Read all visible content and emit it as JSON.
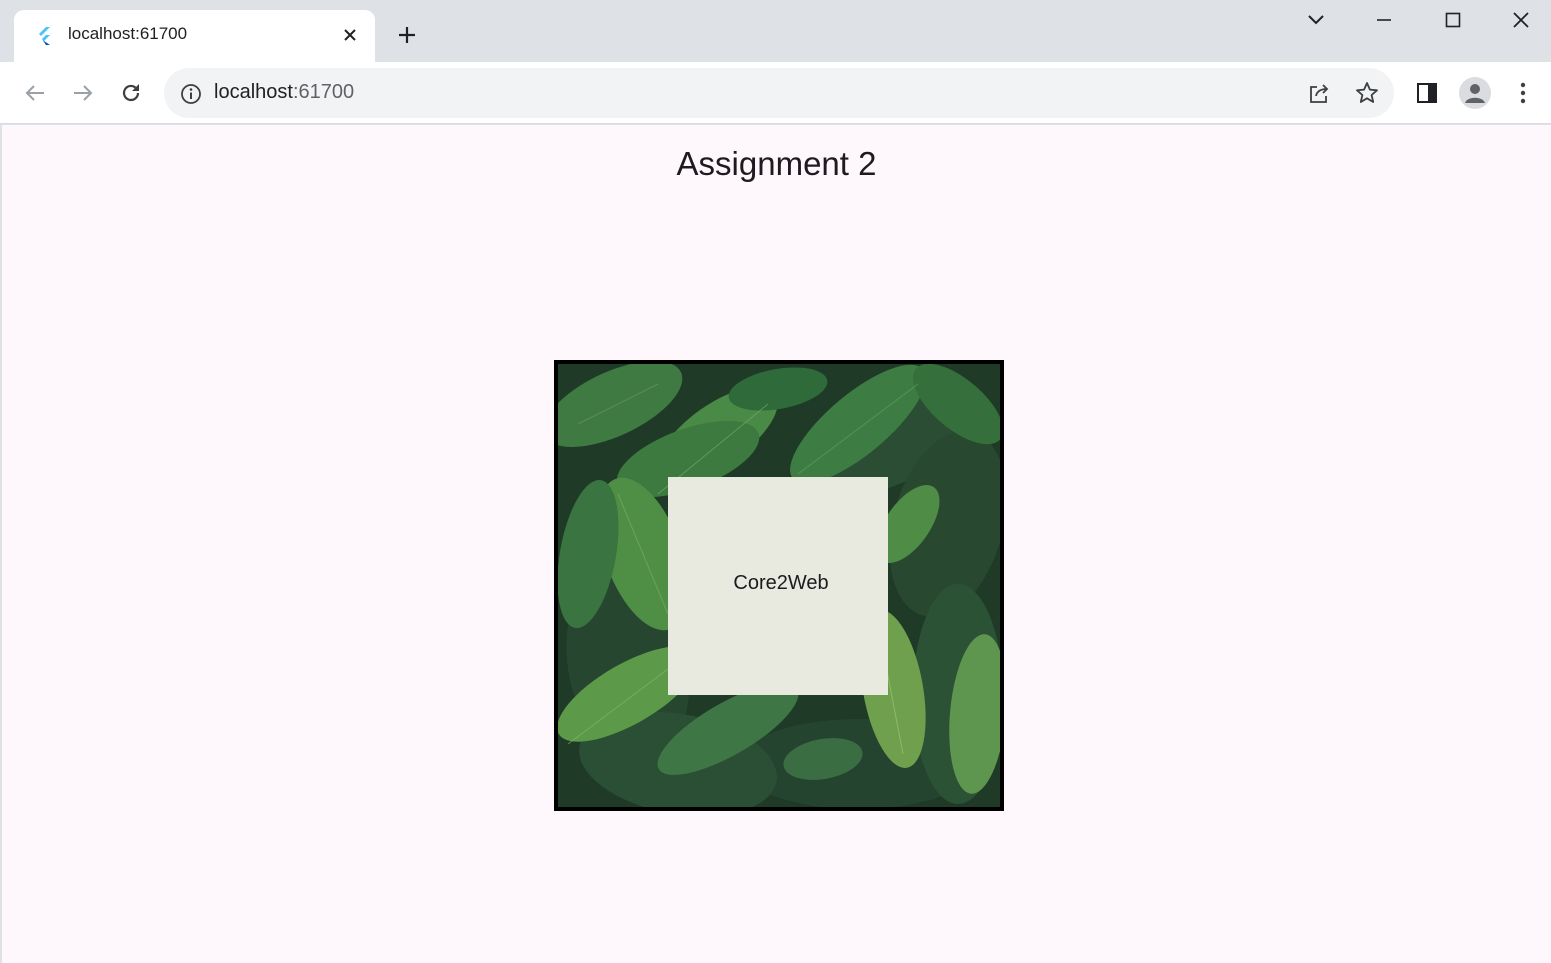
{
  "browser": {
    "tab": {
      "title": "localhost:61700"
    },
    "address": {
      "host": "localhost",
      "port": ":61700"
    }
  },
  "page": {
    "title": "Assignment 2",
    "card_text": "Core2Web"
  },
  "colors": {
    "page_bg": "#fef7fb",
    "frame_border": "#000000",
    "card_bg": "#e8e9df",
    "leaf_dark": "#1f3a26",
    "leaf_mid": "#2f6a3b",
    "leaf_light": "#6fa04d"
  }
}
